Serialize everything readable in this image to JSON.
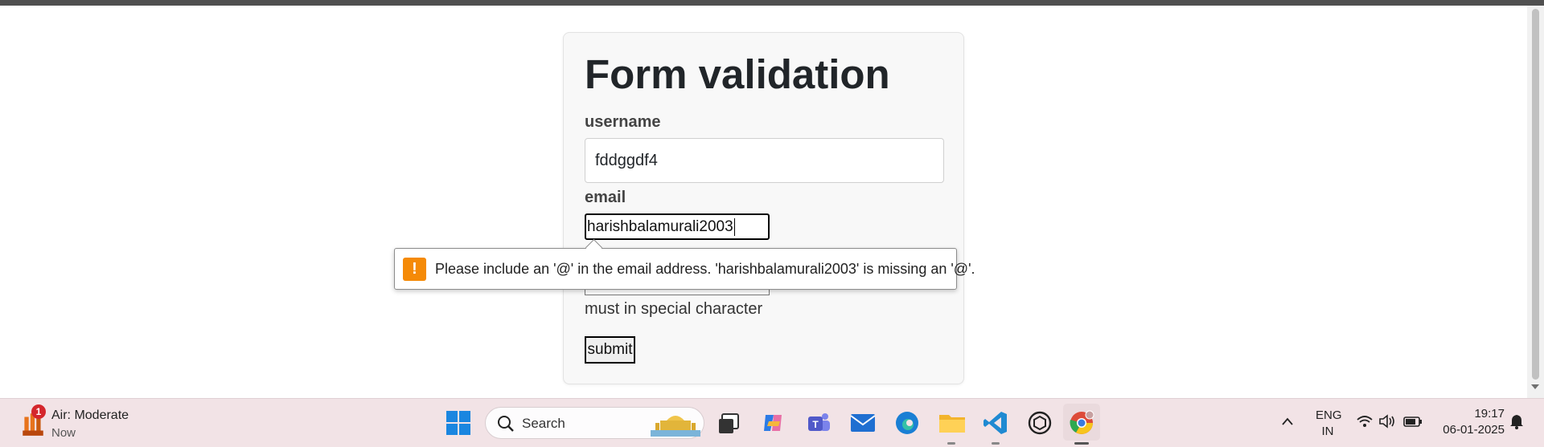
{
  "form": {
    "title": "Form validation",
    "username_label": "username",
    "username_value": "fddggdf4",
    "email_label": "email",
    "email_value": "harishbalamurali2003",
    "hint": "must in special character",
    "submit_label": "submit"
  },
  "validation_tooltip": {
    "message": "Please include an '@' in the email address. 'harishbalamurali2003' is missing an '@'.",
    "icon": "warning-icon",
    "icon_color": "#f58a07"
  },
  "taskbar": {
    "weather": {
      "badge": "1",
      "title": "Air: Moderate",
      "subtitle": "Now"
    },
    "search_placeholder": "Search",
    "apps": [
      "windows-start-icon",
      "task-view-icon",
      "copilot-icon",
      "teams-icon",
      "mail-icon",
      "edge-icon",
      "file-explorer-icon",
      "vscode-icon",
      "chatgpt-icon",
      "chrome-icon"
    ],
    "language": {
      "line1": "ENG",
      "line2": "IN"
    },
    "time": "19:17",
    "date": "06-01-2025"
  },
  "colors": {
    "accent": "#0067c0",
    "taskbar_bg": "#f2e3e6",
    "warning": "#f58a07"
  }
}
